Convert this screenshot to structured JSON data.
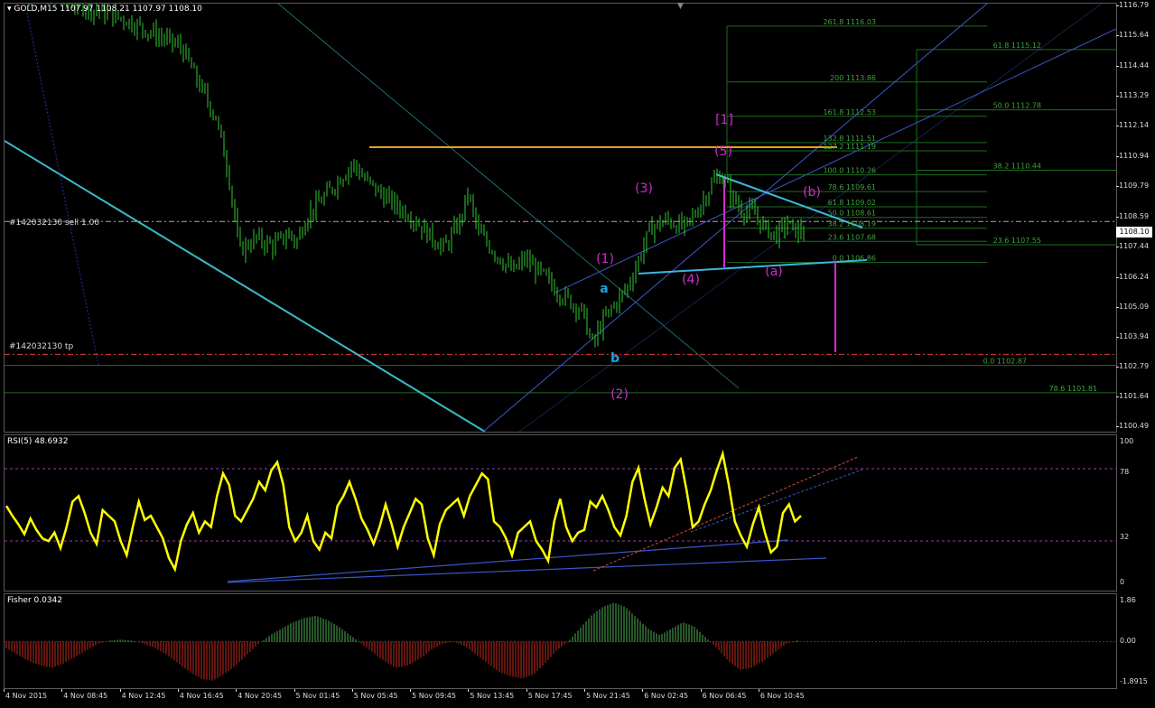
{
  "symbol": {
    "name": "GOLD,M15",
    "open": "1107.97",
    "high": "1108.21",
    "low": "1107.97",
    "close": "1108.10"
  },
  "bid_price": "1108.10",
  "orders": [
    {
      "label": "#142032130 sell 1.00",
      "price": 1108.45
    },
    {
      "label": "#142032130 tp",
      "price": 1103.3
    }
  ],
  "rsi": {
    "label": "RSI(5) 48.6932",
    "levels": [
      "100",
      "78",
      "32",
      "0"
    ]
  },
  "fisher": {
    "label": "Fisher 0.0342",
    "levels": [
      "1.86",
      "0.00",
      "-1.8915"
    ]
  },
  "price_axis": [
    "1116.79",
    "1115.64",
    "1114.44",
    "1113.29",
    "1112.14",
    "1110.94",
    "1109.79",
    "1108.59",
    "1107.44",
    "1106.24",
    "1105.09",
    "1103.94",
    "1102.79",
    "1101.64",
    "1100.49"
  ],
  "time_axis": [
    "4 Nov 2015",
    "4 Nov 08:45",
    "4 Nov 12:45",
    "4 Nov 16:45",
    "4 Nov 20:45",
    "5 Nov 01:45",
    "5 Nov 05:45",
    "5 Nov 09:45",
    "5 Nov 13:45",
    "5 Nov 17:45",
    "5 Nov 21:45",
    "6 Nov 02:45",
    "6 Nov 06:45",
    "6 Nov 10:45"
  ],
  "fib_labels": [
    "261.8 1116.03",
    "61.8 1115.12",
    "200 1113.86",
    "50.0 1112.78",
    "161.8 1112.53",
    "132.8 1111.51",
    "127.2 1111.19",
    "38.2 1110.44",
    "100.0 1110.26",
    "78.6 1109.61",
    "61.8 1109.02",
    "50.0 1108.61",
    "38.2 1108.19",
    "23.6 1107.68",
    "23.6 1107.55",
    "0.0 1106.86",
    "0.0 1102.87",
    "78.6 1101.81"
  ],
  "wave_labels": [
    {
      "text": "[1]",
      "color": "#d22ad2"
    },
    {
      "text": "(5)",
      "color": "#d22ad2"
    },
    {
      "text": "(3)",
      "color": "#d22ad2"
    },
    {
      "text": "(b)",
      "color": "#d22ad2"
    },
    {
      "text": "(1)",
      "color": "#d22ad2"
    },
    {
      "text": "(4)",
      "color": "#d22ad2"
    },
    {
      "text": "(a)",
      "color": "#d22ad2"
    },
    {
      "text": "a",
      "color": "#1fa0e0"
    },
    {
      "text": "b",
      "color": "#1fa0e0"
    },
    {
      "text": "(2)",
      "color": "#d22ad2"
    }
  ],
  "colors": {
    "bull": "#32c832",
    "bear": "#32c832",
    "rsi": "#ffff00",
    "fisher_up": "#4caf50",
    "fisher_down": "#c8281e",
    "order_line": "#e03c3c",
    "channel": "#3a57c8",
    "trend_cyan": "#3cb8c8",
    "resistance": "#e8a020",
    "fib": "#1e6e1e",
    "wave": "#d22ad2"
  },
  "chart_data": [
    {
      "type": "candlestick",
      "title": "GOLD,M15",
      "ylim": [
        1100.3,
        1116.9
      ],
      "x_labels": [
        "4 Nov 2015",
        "4 Nov 08:45",
        "4 Nov 12:45",
        "4 Nov 16:45",
        "4 Nov 20:45",
        "5 Nov 01:45",
        "5 Nov 05:45",
        "5 Nov 09:45",
        "5 Nov 13:45",
        "5 Nov 17:45",
        "5 Nov 21:45",
        "6 Nov 02:45",
        "6 Nov 06:45",
        "6 Nov 10:45"
      ],
      "close_path": [
        [
          0,
          1117.6
        ],
        [
          1,
          1117.0
        ],
        [
          2,
          1116.3
        ],
        [
          3,
          1115.2
        ],
        [
          3.3,
          1113.8
        ],
        [
          3.6,
          1112.5
        ],
        [
          3.8,
          1110.6
        ],
        [
          3.95,
          1108.4
        ],
        [
          4.0,
          1107.3
        ],
        [
          4.3,
          1107.8
        ],
        [
          4.6,
          1107.5
        ],
        [
          4.9,
          1108.0
        ],
        [
          5.0,
          1107.6
        ],
        [
          5.2,
          1108.7
        ],
        [
          5.5,
          1109.4
        ],
        [
          5.8,
          1110.2
        ],
        [
          6.0,
          1110.7
        ],
        [
          6.2,
          1110.1
        ],
        [
          6.5,
          1109.5
        ],
        [
          6.8,
          1109.0
        ],
        [
          7.0,
          1108.7
        ],
        [
          7.3,
          1108.0
        ],
        [
          7.6,
          1107.4
        ],
        [
          7.9,
          1108.6
        ],
        [
          8.0,
          1109.6
        ],
        [
          8.2,
          1108.0
        ],
        [
          8.5,
          1107.2
        ],
        [
          8.8,
          1106.5
        ],
        [
          9.0,
          1107.0
        ],
        [
          9.3,
          1106.4
        ],
        [
          9.6,
          1105.7
        ],
        [
          10.0,
          1105.0
        ],
        [
          10.2,
          1103.6
        ],
        [
          10.3,
          1104.3
        ],
        [
          10.5,
          1105.0
        ],
        [
          10.8,
          1105.9
        ],
        [
          11.0,
          1107.0
        ],
        [
          11.2,
          1108.2
        ],
        [
          11.5,
          1108.5
        ],
        [
          11.8,
          1108.2
        ],
        [
          12.0,
          1108.8
        ],
        [
          12.3,
          1110.0
        ],
        [
          12.45,
          1110.3
        ],
        [
          12.6,
          1109.5
        ],
        [
          12.8,
          1108.9
        ],
        [
          13.0,
          1108.8
        ],
        [
          13.2,
          1108.2
        ],
        [
          13.4,
          1107.9
        ],
        [
          13.6,
          1108.4
        ],
        [
          13.7,
          1108.1
        ]
      ]
    },
    {
      "type": "line",
      "title": "RSI(5) 48.6932",
      "ylim": [
        0,
        100
      ],
      "levels": [
        78,
        32
      ],
      "series": [
        {
          "values": [
            55,
            48,
            42,
            35,
            46,
            38,
            32,
            30,
            36,
            25,
            40,
            58,
            62,
            50,
            36,
            28,
            52,
            48,
            44,
            30,
            20,
            40,
            58,
            45,
            48,
            40,
            32,
            18,
            10,
            30,
            42,
            50,
            36,
            44,
            40,
            62,
            78,
            70,
            48,
            44,
            52,
            60,
            72,
            66,
            80,
            86,
            70,
            40,
            30,
            36,
            48,
            30,
            24,
            36,
            32,
            55,
            62,
            72,
            60,
            46,
            38,
            28,
            40,
            56,
            42,
            26,
            40,
            50,
            60,
            56,
            32,
            20,
            42,
            52,
            56,
            60,
            48,
            62,
            70,
            78,
            74,
            44,
            40,
            32,
            20,
            36,
            40,
            44,
            30,
            24,
            16,
            44,
            60,
            40,
            30,
            36,
            38,
            58,
            54,
            62,
            52,
            40,
            34,
            48,
            72,
            82,
            60,
            42,
            54,
            68,
            62,
            82,
            88,
            66,
            40,
            44,
            56,
            66,
            80,
            92,
            70,
            44,
            34,
            26,
            42,
            54,
            36,
            22,
            26,
            50,
            56,
            44,
            48
          ]
        }
      ]
    },
    {
      "type": "bar",
      "title": "Fisher 0.0342",
      "ylim": [
        -1.8915,
        1.86
      ],
      "series": [
        {
          "values": [
            -0.3,
            -0.6,
            -0.9,
            -1.1,
            -1.2,
            -1.0,
            -0.7,
            -0.4,
            -0.1,
            0.05,
            0.1,
            0.05,
            -0.1,
            -0.3,
            -0.6,
            -1.0,
            -1.4,
            -1.7,
            -1.8,
            -1.5,
            -1.1,
            -0.6,
            -0.1,
            0.3,
            0.6,
            0.9,
            1.1,
            1.2,
            1.0,
            0.7,
            0.3,
            -0.1,
            -0.5,
            -0.9,
            -1.2,
            -1.1,
            -0.8,
            -0.4,
            -0.1,
            0.0,
            -0.2,
            -0.6,
            -1.0,
            -1.4,
            -1.6,
            -1.7,
            -1.5,
            -1.0,
            -0.4,
            0.0,
            0.6,
            1.2,
            1.6,
            1.8,
            1.6,
            1.1,
            0.6,
            0.3,
            0.6,
            0.9,
            0.7,
            0.2,
            -0.3,
            -0.9,
            -1.3,
            -1.2,
            -0.9,
            -0.5,
            -0.1,
            0.05
          ]
        }
      ]
    }
  ]
}
